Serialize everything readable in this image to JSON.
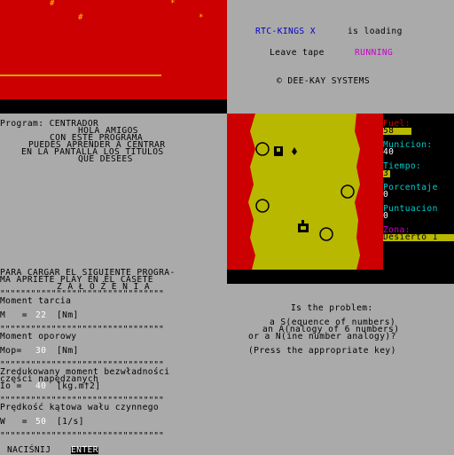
{
  "loader": {
    "title": "RTC-KINGS X",
    "is_loading": "is loading",
    "leave_tape": "Leave tape",
    "running": "RUNNING",
    "copyright": "© DEE-KAY SYSTEMS"
  },
  "centrador": {
    "lines": [
      "Program: CENTRADOR",
      "HOLA AMIGOS",
      "CON ESTE PROGRAMA",
      "PUEDES APRENDER A CENTRAR",
      "EN LA PANTALLA LOS TITULOS",
      "QUE DESEES"
    ]
  },
  "game": {
    "fuel_label": "Fuel:",
    "fuel_value": "58",
    "ammo_label": "Municion:",
    "ammo_value": "40",
    "time_label": "Tiempo:",
    "time_value": "3",
    "percent_label": "Porcentaje",
    "percent_value": "0",
    "score_label": "Puntuacion",
    "score_value": "0",
    "zone_label": "Zona:",
    "zone_value": "Desierto 1"
  },
  "zalozenia": {
    "header1": "PARA CARGAR EL SIGUIENTE PROGRA-",
    "header2": "MA APRIETE PLAY EN EL CASETE",
    "title": "Z A Ł O Ż E N I A",
    "dashes": "\"\"\"\"\"\"\"\"\"\"\"\"\"\"\"\"\"\"\"\"\"\"\"\"\"\"\"\"\"\"\"\"",
    "moment_tarcia_label": "Moment tarcia",
    "m_name": "M   =",
    "m_value": "22",
    "m_unit": "[Nm]",
    "moment_oporowy_label": "Moment oporowy",
    "mop_name": "Mop=",
    "mop_value": "30",
    "mop_unit": "[Nm]",
    "zred_line1": "Zredukowany moment bezwładności",
    "zred_line2": "części napędzanych",
    "io_name": "Io =",
    "io_value": "40",
    "io_unit": "[kg.m†2]",
    "predkosc_label": "Prędkość kątowa wału czynnego",
    "w_name": "W   =",
    "w_value": "50",
    "w_unit": "[1/s]",
    "nacisnij": "NACIŚNIJ",
    "enter": "ENTER"
  },
  "problem": {
    "line1": "Is the problem:",
    "line2": "a S(equence of numbers)",
    "line3": "an A(nalogy of 6 numbers)",
    "line4": "or a N(ine number analogy)?",
    "line5": "(Press the appropriate key)"
  },
  "colors": {
    "red": "#cc0000",
    "yellow": "#b8b800",
    "cyan": "#00cccc",
    "blue": "#0000cc",
    "magenta": "#cc00cc"
  }
}
